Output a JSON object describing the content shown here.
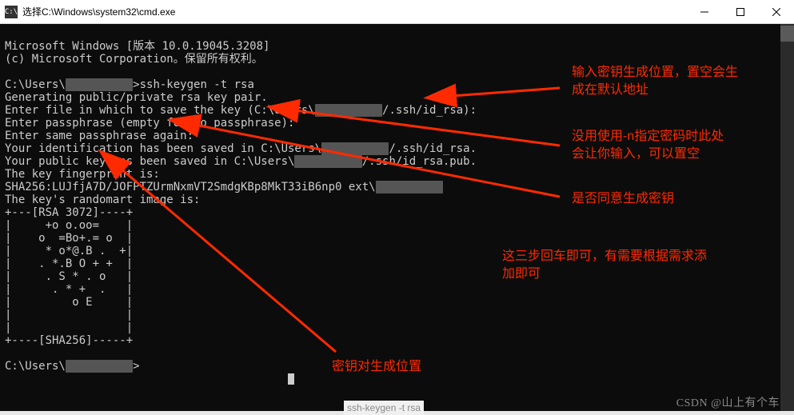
{
  "titlebar": {
    "icon_label": "C:\\",
    "title": "选择C:\\Windows\\system32\\cmd.exe"
  },
  "terminal": {
    "lines": [
      "Microsoft Windows [版本 10.0.19045.3208]",
      "(c) Microsoft Corporation。保留所有权利。",
      "",
      "C:\\Users\\██████████>ssh-keygen -t rsa",
      "Generating public/private rsa key pair.",
      "Enter file in which to save the key (C:\\Users\\██████████/.ssh/id_rsa):",
      "Enter passphrase (empty for no passphrase):",
      "Enter same passphrase again:",
      "Your identification has been saved in C:\\Users\\██████████/.ssh/id_rsa.",
      "Your public key has been saved in C:\\Users\\██████████/.ssh/id_rsa.pub.",
      "The key fingerprint is:",
      "SHA256:LUJfjA7D/JOFPTZUrmNxmVT2SmdgKBp8MkT33iB6np0 ext\\██████████",
      "The key's randomart image is:",
      "+---[RSA 3072]----+",
      "|     +o o.oo=    |",
      "|    o  =Bo+.= o  |",
      "|     * o*@.B .  +|",
      "|    . *.B O + +  |",
      "|     . S * . o   |",
      "|      . * +  .   |",
      "|         o E     |",
      "|                 |",
      "|                 |",
      "+----[SHA256]-----+",
      "",
      "C:\\Users\\██████████>"
    ]
  },
  "annotations": {
    "a1_line1": "输入密钥生成位置，置空会生",
    "a1_line2": "成在默认地址",
    "a2_line1": "没用使用-n指定密码时此处",
    "a2_line2": "会让你输入，可以置空",
    "a3": "是否同意生成密钥",
    "a4_line1": "这三步回车即可，有需要根据需求添",
    "a4_line2": "加即可",
    "a5": "密钥对生成位置"
  },
  "watermark": "CSDN @山上有个车",
  "bottom_fragment": "ssh-keygen -t rsa"
}
